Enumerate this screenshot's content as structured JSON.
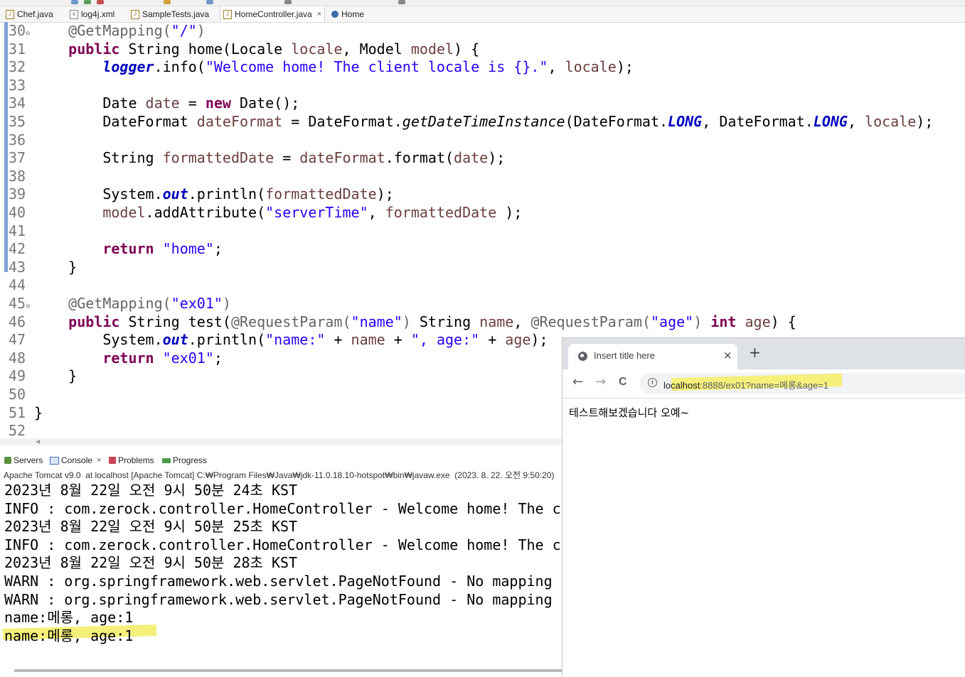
{
  "editor_tabs": [
    {
      "label": "Chef.java",
      "icon": "java-file-icon"
    },
    {
      "label": "log4j.xml",
      "icon": "xml-file-icon"
    },
    {
      "label": "SampleTests.java",
      "icon": "java-file-icon"
    },
    {
      "label": "HomeController.java",
      "icon": "java-file-icon",
      "active": true,
      "close": "×"
    },
    {
      "label": "Home",
      "icon": "globe-icon"
    }
  ],
  "code": {
    "line_numbers": [
      "30",
      "31",
      "32",
      "33",
      "34",
      "35",
      "36",
      "37",
      "38",
      "39",
      "40",
      "41",
      "42",
      "43",
      "44",
      "45",
      "46",
      "47",
      "48",
      "49",
      "50",
      "51",
      "52"
    ],
    "fold_markers": {
      "30": "⊖",
      "45": "⊖"
    }
  },
  "console": {
    "tabs": [
      {
        "label": "Servers",
        "icon": "servers-icon"
      },
      {
        "label": "Console",
        "icon": "console-icon",
        "close": "×"
      },
      {
        "label": "Problems",
        "icon": "problems-icon"
      },
      {
        "label": "Progress",
        "icon": "progress-icon"
      }
    ],
    "description": "Apache Tomcat v9.0  at localhost [Apache Tomcat] C:₩Program Files₩Java₩jdk-11.0.18.10-hotspot₩bin₩javaw.exe  (2023. 8. 22. 오전 9:50:20)",
    "lines": [
      "2023년 8월 22일 오전 9시 50분 24초 KST",
      "INFO : com.zerock.controller.HomeController - Welcome home! The cl",
      "2023년 8월 22일 오전 9시 50분 25초 KST",
      "INFO : com.zerock.controller.HomeController - Welcome home! The cl",
      "2023년 8월 22일 오전 9시 50분 28초 KST",
      "WARN : org.springframework.web.servlet.PageNotFound - No mapping f",
      "WARN : org.springframework.web.servlet.PageNotFound - No mapping f",
      "name:메롱, age:1",
      "name:메롱, age:1"
    ]
  },
  "browser": {
    "tab_title": "Insert title here",
    "tab_close": "×",
    "new_tab": "+",
    "back": "←",
    "forward": "→",
    "reload": "C",
    "info_icon": "i",
    "url_host": "localhost",
    "url_rest": ":8888/ex01?name=메롱&age=1",
    "page_text": "테스트해보겠습니다 오예~"
  },
  "highlight_color": "#f5f07a"
}
